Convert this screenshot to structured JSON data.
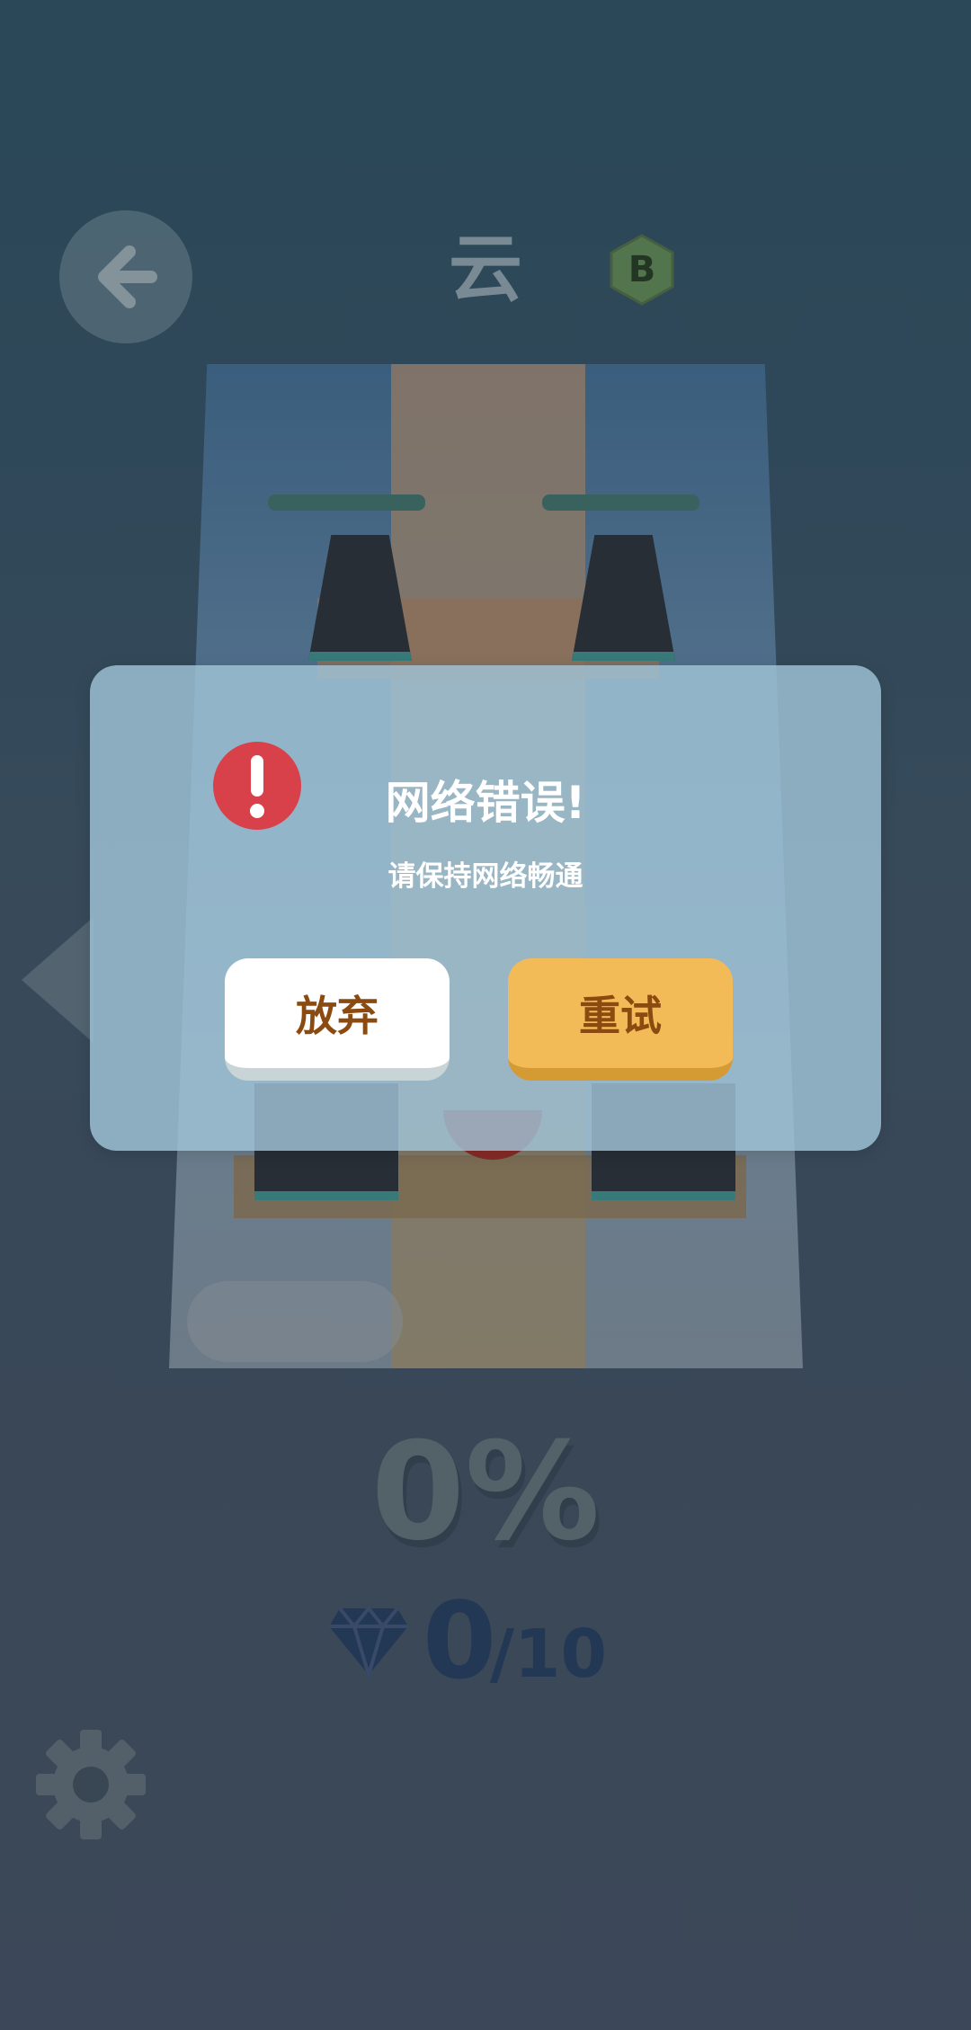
{
  "header": {
    "back_icon": "arrow-left-icon",
    "level_name": "云",
    "grade_badge": "B"
  },
  "game": {
    "progress_percent_label": "0%",
    "progress_percent": 0,
    "gems_collected": "0",
    "gems_total": "/10",
    "gem_icon": "diamond-icon",
    "settings_icon": "gear-icon",
    "side_arrow_icon": "triangle-left-icon"
  },
  "dialog": {
    "icon": "exclamation-circle-icon",
    "title": "网络错误!",
    "message": "请保持网络畅通",
    "giveup_label": "放弃",
    "retry_label": "重试"
  },
  "colors": {
    "error_red": "#d9414a",
    "retry_button": "#f2bb58",
    "button_text": "#8a4a10",
    "dialog_bg": "#a0c3d7"
  }
}
